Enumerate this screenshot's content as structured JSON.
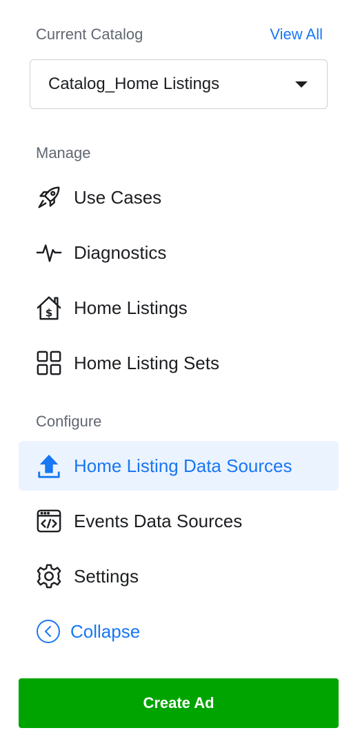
{
  "catalog": {
    "heading": "Current Catalog",
    "view_all_label": "View All",
    "selected": "Catalog_Home Listings"
  },
  "manage": {
    "section_label": "Manage",
    "items": [
      {
        "label": "Use Cases",
        "icon": "rocket-icon"
      },
      {
        "label": "Diagnostics",
        "icon": "pulse-icon"
      },
      {
        "label": "Home Listings",
        "icon": "house-dollar-icon"
      },
      {
        "label": "Home Listing Sets",
        "icon": "grid-icon"
      }
    ]
  },
  "configure": {
    "section_label": "Configure",
    "items": [
      {
        "label": "Home Listing Data Sources",
        "icon": "upload-icon",
        "active": true
      },
      {
        "label": "Events Data Sources",
        "icon": "code-window-icon"
      },
      {
        "label": "Settings",
        "icon": "gear-icon"
      }
    ]
  },
  "collapse": {
    "label": "Collapse",
    "icon": "chevron-left-circle-icon"
  },
  "create_ad": {
    "label": "Create Ad"
  },
  "colors": {
    "accent": "#1877f2",
    "active_bg": "#ebf3ff",
    "create_button": "#00a400",
    "muted_text": "#606770"
  }
}
